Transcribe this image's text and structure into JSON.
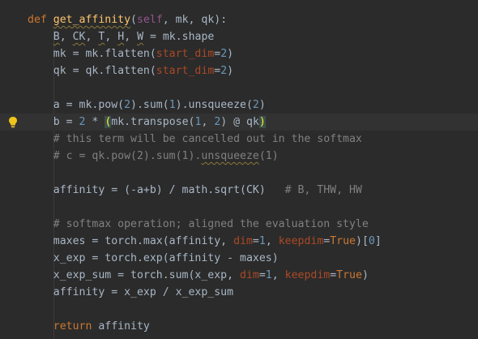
{
  "editor": {
    "lines": [
      {
        "tokens": [
          {
            "t": "def ",
            "c": "kw"
          },
          {
            "t": "get_affinity",
            "c": "fn wavy"
          },
          {
            "t": "(",
            "c": ""
          },
          {
            "t": "self",
            "c": "self"
          },
          {
            "t": ", mk, qk):",
            "c": ""
          }
        ]
      },
      {
        "tokens": [
          {
            "t": "    ",
            "c": ""
          },
          {
            "t": "B",
            "c": "wavy"
          },
          {
            "t": ", ",
            "c": ""
          },
          {
            "t": "CK",
            "c": "wavy"
          },
          {
            "t": ", ",
            "c": ""
          },
          {
            "t": "T",
            "c": "wavy"
          },
          {
            "t": ", ",
            "c": ""
          },
          {
            "t": "H",
            "c": "wavy"
          },
          {
            "t": ", ",
            "c": ""
          },
          {
            "t": "W",
            "c": "wavy"
          },
          {
            "t": " = mk.shape",
            "c": ""
          }
        ]
      },
      {
        "tokens": [
          {
            "t": "    mk = mk.flatten(",
            "c": ""
          },
          {
            "t": "start_dim",
            "c": "param"
          },
          {
            "t": "=",
            "c": ""
          },
          {
            "t": "2",
            "c": "num"
          },
          {
            "t": ")",
            "c": ""
          }
        ]
      },
      {
        "tokens": [
          {
            "t": "    qk = qk.flatten(",
            "c": ""
          },
          {
            "t": "start_dim",
            "c": "param"
          },
          {
            "t": "=",
            "c": ""
          },
          {
            "t": "2",
            "c": "num"
          },
          {
            "t": ")",
            "c": ""
          }
        ]
      },
      {
        "tokens": []
      },
      {
        "tokens": [
          {
            "t": "    a = mk.pow(",
            "c": ""
          },
          {
            "t": "2",
            "c": "num"
          },
          {
            "t": ").sum(",
            "c": ""
          },
          {
            "t": "1",
            "c": "num"
          },
          {
            "t": ").unsqueeze(",
            "c": ""
          },
          {
            "t": "2",
            "c": "num"
          },
          {
            "t": ")",
            "c": ""
          }
        ]
      },
      {
        "current": true,
        "bulb": true,
        "tokens": [
          {
            "t": "    b = ",
            "c": ""
          },
          {
            "t": "2",
            "c": "num"
          },
          {
            "t": " * ",
            "c": ""
          },
          {
            "t": "(",
            "c": "bracket"
          },
          {
            "t": "mk.transpose(",
            "c": ""
          },
          {
            "t": "1",
            "c": "num"
          },
          {
            "t": ", ",
            "c": ""
          },
          {
            "t": "2",
            "c": "num"
          },
          {
            "t": ") @ qk",
            "c": ""
          },
          {
            "t": ")",
            "c": "bracket"
          }
        ]
      },
      {
        "tokens": [
          {
            "t": "    # this term will be cancelled out in the softmax",
            "c": "cmt"
          }
        ]
      },
      {
        "tokens": [
          {
            "t": "    # c = qk.pow(2).sum(1).",
            "c": "cmt"
          },
          {
            "t": "unsqueeze",
            "c": "cmt wavy"
          },
          {
            "t": "(1)",
            "c": "cmt"
          }
        ]
      },
      {
        "tokens": []
      },
      {
        "tokens": [
          {
            "t": "    affinity = (-a+b) / math.sqrt(CK)   ",
            "c": ""
          },
          {
            "t": "# B, THW, HW",
            "c": "cmt"
          }
        ]
      },
      {
        "tokens": []
      },
      {
        "tokens": [
          {
            "t": "    # softmax operation; aligned the evaluation style",
            "c": "cmt"
          }
        ]
      },
      {
        "tokens": [
          {
            "t": "    maxes = torch.max(affinity, ",
            "c": ""
          },
          {
            "t": "dim",
            "c": "param"
          },
          {
            "t": "=",
            "c": ""
          },
          {
            "t": "1",
            "c": "num"
          },
          {
            "t": ", ",
            "c": ""
          },
          {
            "t": "keepdim",
            "c": "param"
          },
          {
            "t": "=",
            "c": ""
          },
          {
            "t": "True",
            "c": "kw"
          },
          {
            "t": ")[",
            "c": ""
          },
          {
            "t": "0",
            "c": "num"
          },
          {
            "t": "]",
            "c": ""
          }
        ]
      },
      {
        "tokens": [
          {
            "t": "    x_exp = torch.exp(affinity - maxes)",
            "c": ""
          }
        ]
      },
      {
        "tokens": [
          {
            "t": "    x_exp_sum = torch.sum(x_exp, ",
            "c": ""
          },
          {
            "t": "dim",
            "c": "param"
          },
          {
            "t": "=",
            "c": ""
          },
          {
            "t": "1",
            "c": "num"
          },
          {
            "t": ", ",
            "c": ""
          },
          {
            "t": "keepdim",
            "c": "param"
          },
          {
            "t": "=",
            "c": ""
          },
          {
            "t": "True",
            "c": "kw"
          },
          {
            "t": ")",
            "c": ""
          }
        ]
      },
      {
        "tokens": [
          {
            "t": "    affinity = x_exp / x_exp_sum",
            "c": ""
          }
        ]
      },
      {
        "tokens": []
      },
      {
        "tokens": [
          {
            "t": "    ",
            "c": ""
          },
          {
            "t": "return",
            "c": "kw"
          },
          {
            "t": " affinity",
            "c": ""
          }
        ]
      }
    ],
    "colors": {
      "background": "#2b2b2b",
      "keyword": "#cc7832",
      "function": "#ffc66d",
      "comment": "#808080",
      "number": "#6897bb",
      "param": "#aa4926"
    },
    "icons": {
      "intention": "lightbulb-icon"
    }
  }
}
